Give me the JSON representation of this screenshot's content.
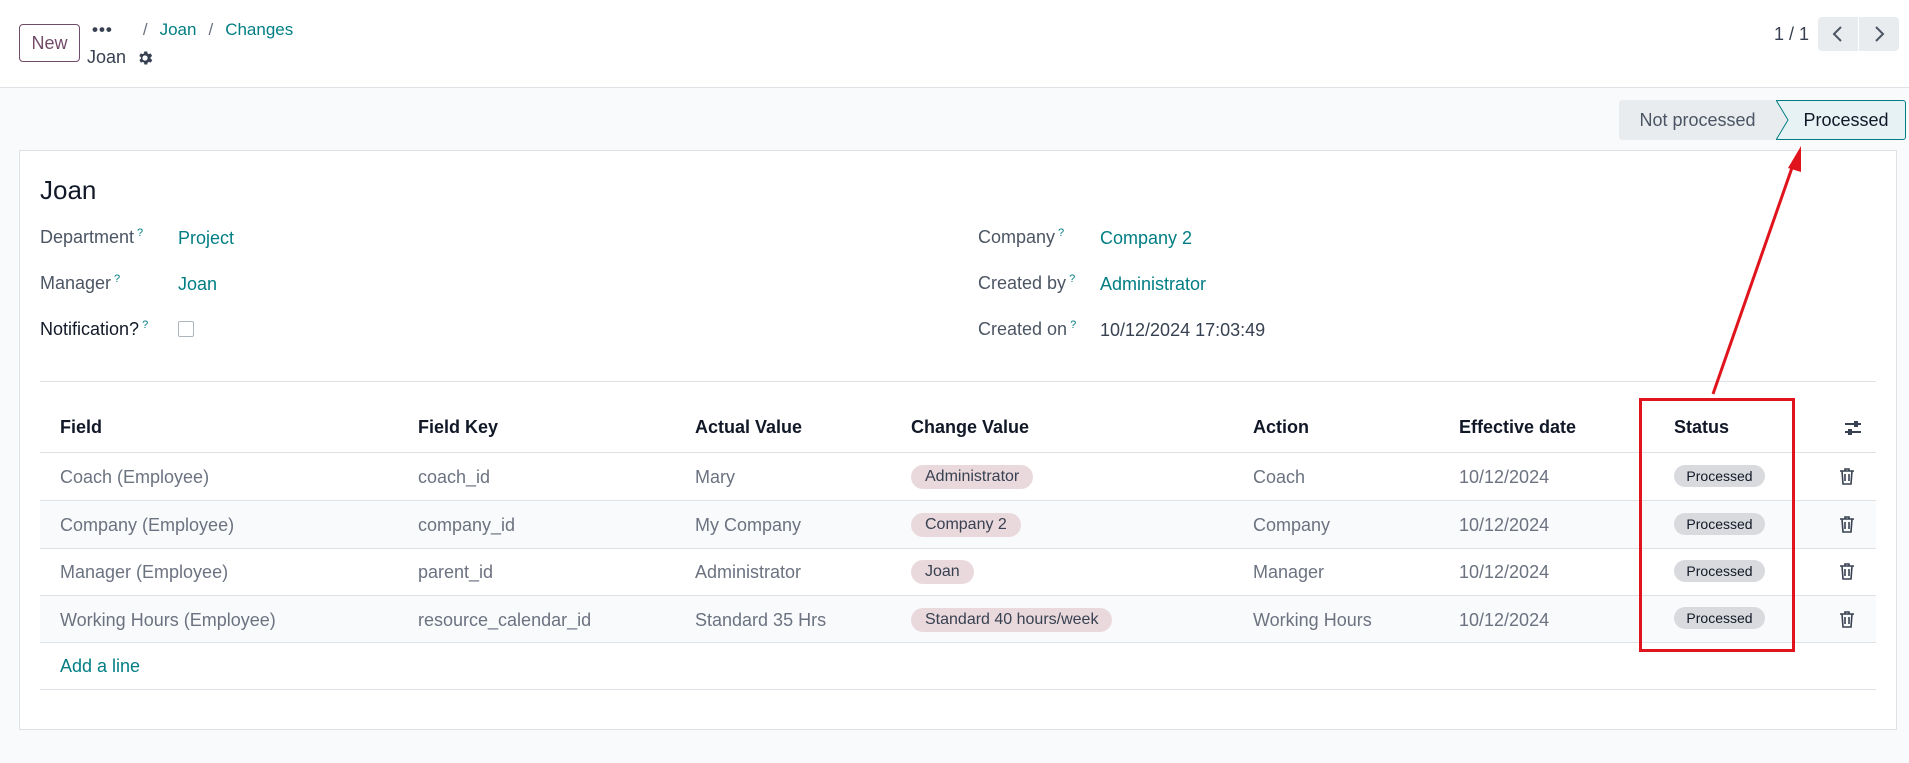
{
  "toolbar": {
    "new_label": "New"
  },
  "breadcrumb": {
    "dots": "•••",
    "sep": "/",
    "items": [
      "Joan",
      "Changes"
    ]
  },
  "record_title": "Joan",
  "pager": {
    "text": "1 / 1"
  },
  "statusbar": {
    "stages": [
      "Not processed",
      "Processed"
    ],
    "active": "Processed"
  },
  "form": {
    "title": "Joan",
    "help_mark": "?",
    "left": [
      {
        "label": "Department",
        "value": "Project"
      },
      {
        "label": "Manager",
        "value": "Joan"
      },
      {
        "label": "Notification?",
        "value": ""
      }
    ],
    "right": [
      {
        "label": "Company",
        "value": "Company 2"
      },
      {
        "label": "Created by",
        "value": "Administrator"
      },
      {
        "label": "Created on",
        "value": "10/12/2024 17:03:49"
      }
    ]
  },
  "table": {
    "headers": [
      "Field",
      "Field Key",
      "Actual Value",
      "Change Value",
      "Action",
      "Effective date",
      "Status"
    ],
    "rows": [
      {
        "field": "Coach (Employee)",
        "key": "coach_id",
        "actual": "Mary",
        "change": "Administrator",
        "action": "Coach",
        "date": "10/12/2024",
        "status": "Processed"
      },
      {
        "field": "Company (Employee)",
        "key": "company_id",
        "actual": "My Company",
        "change": "Company 2",
        "action": "Company",
        "date": "10/12/2024",
        "status": "Processed"
      },
      {
        "field": "Manager (Employee)",
        "key": "parent_id",
        "actual": "Administrator",
        "change": "Joan",
        "action": "Manager",
        "date": "10/12/2024",
        "status": "Processed"
      },
      {
        "field": "Working Hours (Employee)",
        "key": "resource_calendar_id",
        "actual": "Standard 35 Hrs",
        "change": "Standard 40 hours/week",
        "action": "Working Hours",
        "date": "10/12/2024",
        "status": "Processed"
      }
    ],
    "add_line": "Add a line"
  },
  "colors": {
    "accent": "#017e84",
    "brand": "#714b67",
    "annotation": "#e0141c"
  },
  "icons": [
    "gear-icon",
    "chevron-left-icon",
    "chevron-right-icon",
    "column-settings-icon",
    "trash-icon"
  ]
}
